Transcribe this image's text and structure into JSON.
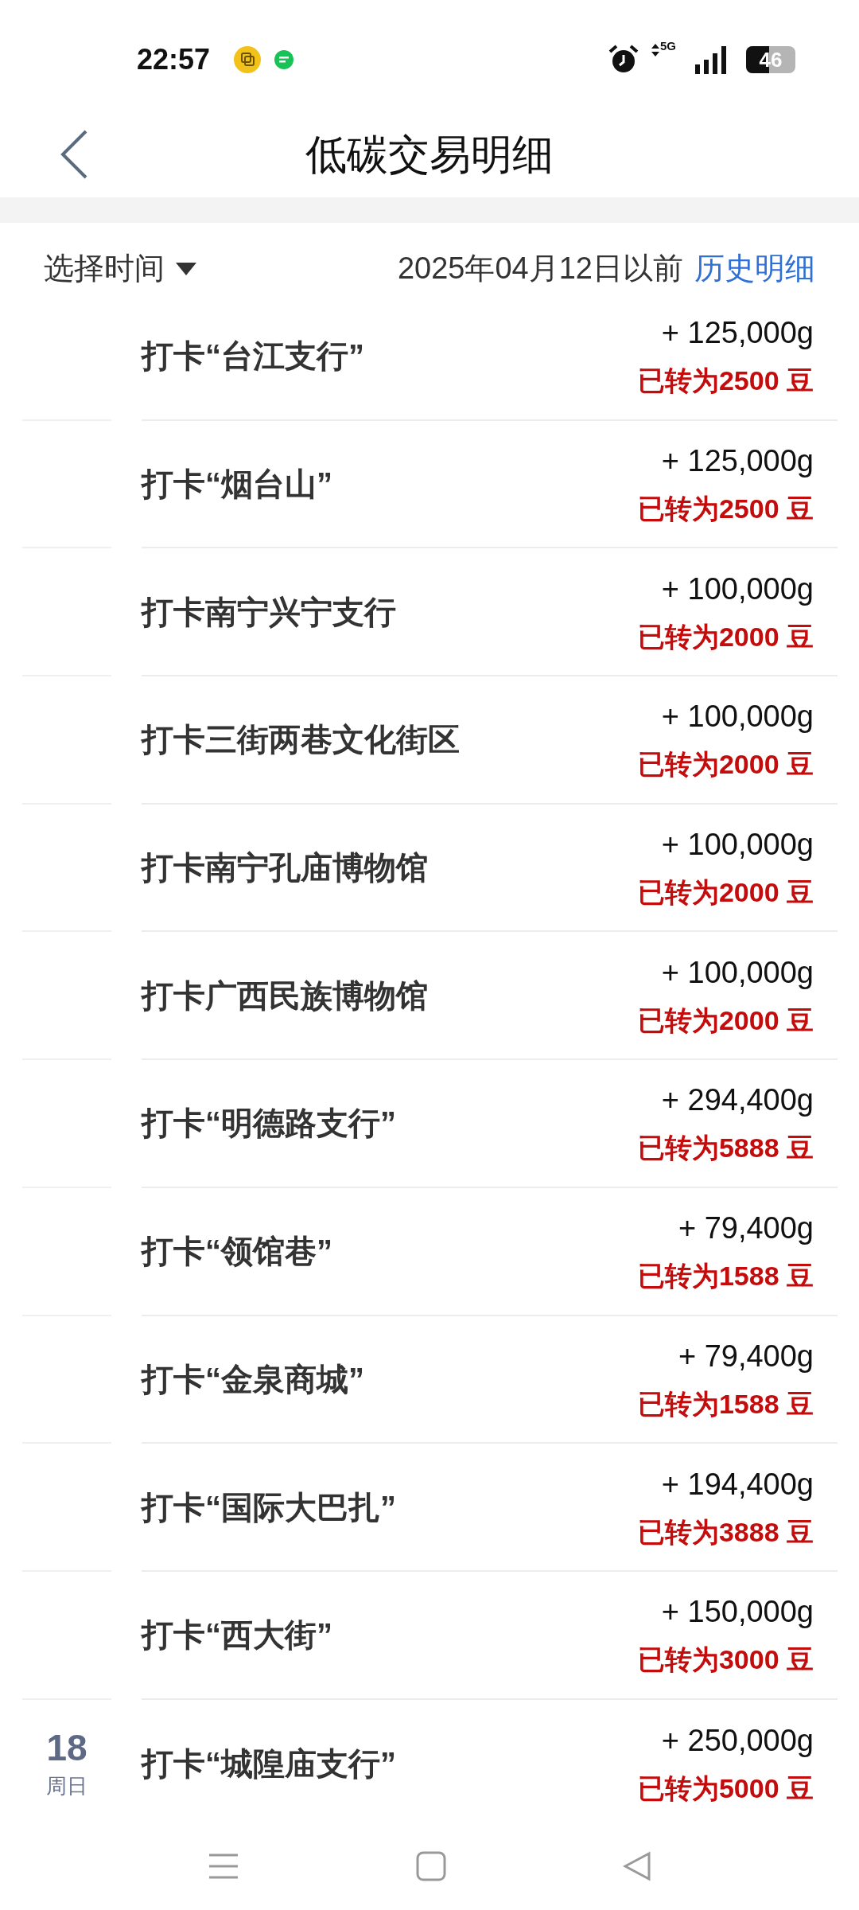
{
  "status_bar": {
    "time": "22:57",
    "battery": "46",
    "network": "5G"
  },
  "header": {
    "title": "低碳交易明细"
  },
  "filter": {
    "select_label": "选择时间",
    "date_note": "2025年04月12日以前",
    "history_link": "历史明细"
  },
  "rows": [
    {
      "title": "打卡“台江支行”",
      "amount": "+ 125,000g",
      "converted": "已转为2500 豆"
    },
    {
      "title": "打卡“烟台山”",
      "amount": "+ 125,000g",
      "converted": "已转为2500 豆"
    },
    {
      "title": "打卡南宁兴宁支行",
      "amount": "+ 100,000g",
      "converted": "已转为2000 豆"
    },
    {
      "title": "打卡三街两巷文化街区",
      "amount": "+ 100,000g",
      "converted": "已转为2000 豆"
    },
    {
      "title": "打卡南宁孔庙博物馆",
      "amount": "+ 100,000g",
      "converted": "已转为2000 豆"
    },
    {
      "title": "打卡广西民族博物馆",
      "amount": "+ 100,000g",
      "converted": "已转为2000 豆"
    },
    {
      "title": "打卡“明德路支行”",
      "amount": "+ 294,400g",
      "converted": "已转为5888 豆"
    },
    {
      "title": "打卡“领馆巷”",
      "amount": "+ 79,400g",
      "converted": "已转为1588 豆"
    },
    {
      "title": "打卡“金泉商城”",
      "amount": "+ 79,400g",
      "converted": "已转为1588 豆"
    },
    {
      "title": "打卡“国际大巴扎”",
      "amount": "+ 194,400g",
      "converted": "已转为3888 豆"
    },
    {
      "title": "打卡“西大街”",
      "amount": "+ 150,000g",
      "converted": "已转为3000 豆"
    },
    {
      "title": "打卡“城隍庙支行”",
      "amount": "+ 250,000g",
      "converted": "已转为5000 豆",
      "day": "18",
      "weekday": "周日"
    }
  ]
}
